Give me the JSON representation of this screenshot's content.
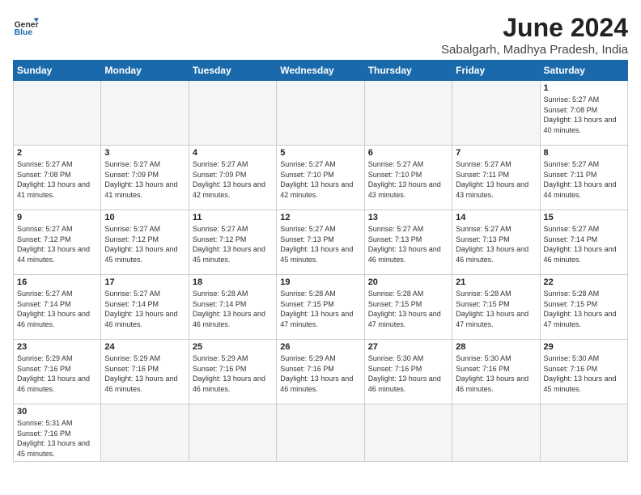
{
  "header": {
    "logo_general": "General",
    "logo_blue": "Blue",
    "title": "June 2024",
    "subtitle": "Sabalgarh, Madhya Pradesh, India"
  },
  "weekdays": [
    "Sunday",
    "Monday",
    "Tuesday",
    "Wednesday",
    "Thursday",
    "Friday",
    "Saturday"
  ],
  "weeks": [
    [
      {
        "day": "",
        "empty": true
      },
      {
        "day": "",
        "empty": true
      },
      {
        "day": "",
        "empty": true
      },
      {
        "day": "",
        "empty": true
      },
      {
        "day": "",
        "empty": true
      },
      {
        "day": "",
        "empty": true
      },
      {
        "day": "1",
        "sunrise": "5:27 AM",
        "sunset": "7:08 PM",
        "daylight": "13 hours and 40 minutes."
      }
    ],
    [
      {
        "day": "2",
        "sunrise": "5:27 AM",
        "sunset": "7:08 PM",
        "daylight": "13 hours and 41 minutes."
      },
      {
        "day": "3",
        "sunrise": "5:27 AM",
        "sunset": "7:09 PM",
        "daylight": "13 hours and 41 minutes."
      },
      {
        "day": "4",
        "sunrise": "5:27 AM",
        "sunset": "7:09 PM",
        "daylight": "13 hours and 42 minutes."
      },
      {
        "day": "5",
        "sunrise": "5:27 AM",
        "sunset": "7:10 PM",
        "daylight": "13 hours and 42 minutes."
      },
      {
        "day": "6",
        "sunrise": "5:27 AM",
        "sunset": "7:10 PM",
        "daylight": "13 hours and 43 minutes."
      },
      {
        "day": "7",
        "sunrise": "5:27 AM",
        "sunset": "7:11 PM",
        "daylight": "13 hours and 43 minutes."
      },
      {
        "day": "8",
        "sunrise": "5:27 AM",
        "sunset": "7:11 PM",
        "daylight": "13 hours and 44 minutes."
      }
    ],
    [
      {
        "day": "9",
        "sunrise": "5:27 AM",
        "sunset": "7:12 PM",
        "daylight": "13 hours and 44 minutes."
      },
      {
        "day": "10",
        "sunrise": "5:27 AM",
        "sunset": "7:12 PM",
        "daylight": "13 hours and 45 minutes."
      },
      {
        "day": "11",
        "sunrise": "5:27 AM",
        "sunset": "7:12 PM",
        "daylight": "13 hours and 45 minutes."
      },
      {
        "day": "12",
        "sunrise": "5:27 AM",
        "sunset": "7:13 PM",
        "daylight": "13 hours and 45 minutes."
      },
      {
        "day": "13",
        "sunrise": "5:27 AM",
        "sunset": "7:13 PM",
        "daylight": "13 hours and 46 minutes."
      },
      {
        "day": "14",
        "sunrise": "5:27 AM",
        "sunset": "7:13 PM",
        "daylight": "13 hours and 46 minutes."
      },
      {
        "day": "15",
        "sunrise": "5:27 AM",
        "sunset": "7:14 PM",
        "daylight": "13 hours and 46 minutes."
      }
    ],
    [
      {
        "day": "16",
        "sunrise": "5:27 AM",
        "sunset": "7:14 PM",
        "daylight": "13 hours and 46 minutes."
      },
      {
        "day": "17",
        "sunrise": "5:27 AM",
        "sunset": "7:14 PM",
        "daylight": "13 hours and 46 minutes."
      },
      {
        "day": "18",
        "sunrise": "5:28 AM",
        "sunset": "7:14 PM",
        "daylight": "13 hours and 46 minutes."
      },
      {
        "day": "19",
        "sunrise": "5:28 AM",
        "sunset": "7:15 PM",
        "daylight": "13 hours and 47 minutes."
      },
      {
        "day": "20",
        "sunrise": "5:28 AM",
        "sunset": "7:15 PM",
        "daylight": "13 hours and 47 minutes."
      },
      {
        "day": "21",
        "sunrise": "5:28 AM",
        "sunset": "7:15 PM",
        "daylight": "13 hours and 47 minutes."
      },
      {
        "day": "22",
        "sunrise": "5:28 AM",
        "sunset": "7:15 PM",
        "daylight": "13 hours and 47 minutes."
      }
    ],
    [
      {
        "day": "23",
        "sunrise": "5:29 AM",
        "sunset": "7:16 PM",
        "daylight": "13 hours and 46 minutes."
      },
      {
        "day": "24",
        "sunrise": "5:29 AM",
        "sunset": "7:16 PM",
        "daylight": "13 hours and 46 minutes."
      },
      {
        "day": "25",
        "sunrise": "5:29 AM",
        "sunset": "7:16 PM",
        "daylight": "13 hours and 46 minutes."
      },
      {
        "day": "26",
        "sunrise": "5:29 AM",
        "sunset": "7:16 PM",
        "daylight": "13 hours and 46 minutes."
      },
      {
        "day": "27",
        "sunrise": "5:30 AM",
        "sunset": "7:16 PM",
        "daylight": "13 hours and 46 minutes."
      },
      {
        "day": "28",
        "sunrise": "5:30 AM",
        "sunset": "7:16 PM",
        "daylight": "13 hours and 46 minutes."
      },
      {
        "day": "29",
        "sunrise": "5:30 AM",
        "sunset": "7:16 PM",
        "daylight": "13 hours and 45 minutes."
      }
    ],
    [
      {
        "day": "30",
        "sunrise": "5:31 AM",
        "sunset": "7:16 PM",
        "daylight": "13 hours and 45 minutes."
      },
      {
        "day": "",
        "empty": true
      },
      {
        "day": "",
        "empty": true
      },
      {
        "day": "",
        "empty": true
      },
      {
        "day": "",
        "empty": true
      },
      {
        "day": "",
        "empty": true
      },
      {
        "day": "",
        "empty": true
      }
    ]
  ]
}
